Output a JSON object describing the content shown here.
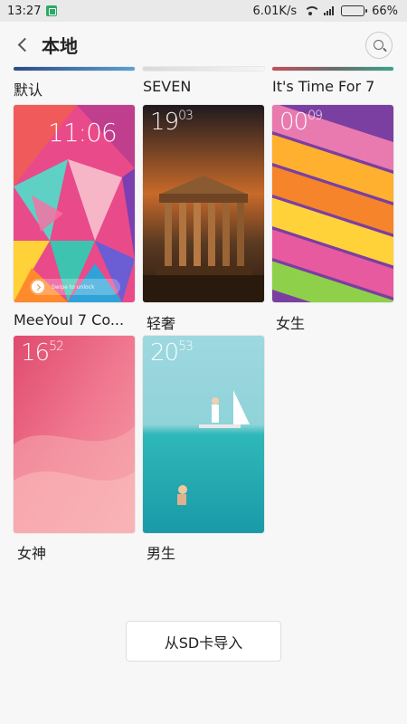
{
  "status_bar": {
    "time": "13:27",
    "net_speed": "6.01K/s",
    "battery_text": "66%",
    "battery_level": 0.66
  },
  "header": {
    "title": "本地"
  },
  "themes": [
    {
      "label": "默认"
    },
    {
      "label": "SEVEN"
    },
    {
      "label": "It's Time For 7"
    },
    {
      "label": "MeeYouI 7 Co...",
      "clock": "11:06",
      "unlock_text": "Swipe to unlock"
    },
    {
      "label": "轻奢",
      "clock_main": "19",
      "clock_small": "03"
    },
    {
      "label": "女生",
      "clock_main": "00",
      "clock_small": "09"
    },
    {
      "label": "女神",
      "clock_main": "16",
      "clock_small": "52"
    },
    {
      "label": "男生",
      "clock_main": "20",
      "clock_small": "53"
    }
  ],
  "import_button": "从SD卡导入",
  "colors": {
    "page_bg": "#f7f7f7",
    "statusbar_bg": "#e9e9e9",
    "accent_green": "#2fa866"
  }
}
